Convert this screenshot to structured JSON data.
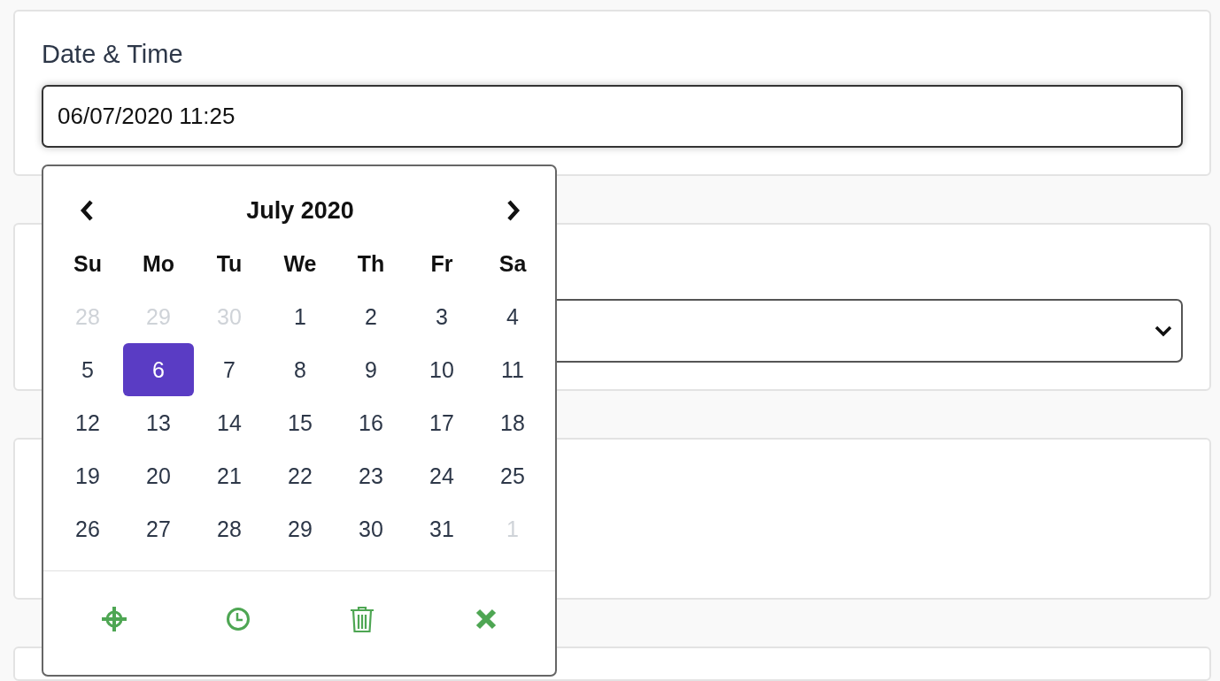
{
  "date_time_field": {
    "label": "Date & Time",
    "value": "06/07/2020 11:25"
  },
  "calendar": {
    "month_title": "July 2020",
    "weekdays": [
      "Su",
      "Mo",
      "Tu",
      "We",
      "Th",
      "Fr",
      "Sa"
    ],
    "days": [
      {
        "label": "28",
        "muted": true,
        "selected": false
      },
      {
        "label": "29",
        "muted": true,
        "selected": false
      },
      {
        "label": "30",
        "muted": true,
        "selected": false
      },
      {
        "label": "1",
        "muted": false,
        "selected": false
      },
      {
        "label": "2",
        "muted": false,
        "selected": false
      },
      {
        "label": "3",
        "muted": false,
        "selected": false
      },
      {
        "label": "4",
        "muted": false,
        "selected": false
      },
      {
        "label": "5",
        "muted": false,
        "selected": false
      },
      {
        "label": "6",
        "muted": false,
        "selected": true
      },
      {
        "label": "7",
        "muted": false,
        "selected": false
      },
      {
        "label": "8",
        "muted": false,
        "selected": false
      },
      {
        "label": "9",
        "muted": false,
        "selected": false
      },
      {
        "label": "10",
        "muted": false,
        "selected": false
      },
      {
        "label": "11",
        "muted": false,
        "selected": false
      },
      {
        "label": "12",
        "muted": false,
        "selected": false
      },
      {
        "label": "13",
        "muted": false,
        "selected": false
      },
      {
        "label": "14",
        "muted": false,
        "selected": false
      },
      {
        "label": "15",
        "muted": false,
        "selected": false
      },
      {
        "label": "16",
        "muted": false,
        "selected": false
      },
      {
        "label": "17",
        "muted": false,
        "selected": false
      },
      {
        "label": "18",
        "muted": false,
        "selected": false
      },
      {
        "label": "19",
        "muted": false,
        "selected": false
      },
      {
        "label": "20",
        "muted": false,
        "selected": false
      },
      {
        "label": "21",
        "muted": false,
        "selected": false
      },
      {
        "label": "22",
        "muted": false,
        "selected": false
      },
      {
        "label": "23",
        "muted": false,
        "selected": false
      },
      {
        "label": "24",
        "muted": false,
        "selected": false
      },
      {
        "label": "25",
        "muted": false,
        "selected": false
      },
      {
        "label": "26",
        "muted": false,
        "selected": false
      },
      {
        "label": "27",
        "muted": false,
        "selected": false
      },
      {
        "label": "28",
        "muted": false,
        "selected": false
      },
      {
        "label": "29",
        "muted": false,
        "selected": false
      },
      {
        "label": "30",
        "muted": false,
        "selected": false
      },
      {
        "label": "31",
        "muted": false,
        "selected": false
      },
      {
        "label": "1",
        "muted": true,
        "selected": false
      }
    ],
    "actions": [
      {
        "kind": "today"
      },
      {
        "kind": "time"
      },
      {
        "kind": "clear"
      },
      {
        "kind": "close"
      }
    ]
  },
  "cards": [
    {
      "kind": "select"
    },
    {
      "kind": "empty"
    },
    {
      "kind": "empty"
    }
  ]
}
